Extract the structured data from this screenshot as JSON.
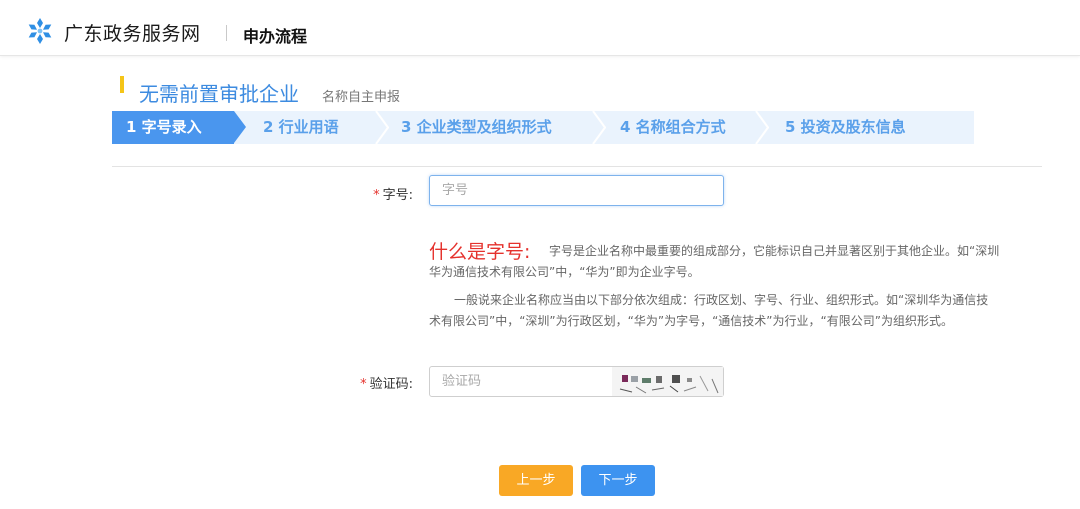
{
  "header": {
    "site_name": "广东政务服务网",
    "sub_title": "申办流程"
  },
  "title": {
    "main": "无需前置审批企业",
    "sub": "名称自主申报"
  },
  "steps": [
    {
      "label": "1 字号录入",
      "active": true
    },
    {
      "label": "2 行业用语",
      "active": false
    },
    {
      "label": "3 企业类型及组织形式",
      "active": false
    },
    {
      "label": "4 名称组合方式",
      "active": false
    },
    {
      "label": "5 投资及股东信息",
      "active": false
    }
  ],
  "form": {
    "name_label": "字号:",
    "name_placeholder": "字号",
    "captcha_label": "验证码:",
    "captcha_placeholder": "验证码"
  },
  "help": {
    "title": "什么是字号:",
    "para1_line1": "字号是企业名称中最重要的组成部分，它能标识自己并显著区别于其他企业。如“深圳",
    "para1_line2": "华为通信技术有限公司”中，“华为”即为企业字号。",
    "para2_line1": "一般说来企业名称应当由以下部分依次组成：行政区划、字号、行业、组织形式。如“深圳华为通信技",
    "para2_line2": "术有限公司”中，“深圳”为行政区划，“华为”为字号，“通信技术”为行业，“有限公司”为组织形式。"
  },
  "buttons": {
    "prev": "上一步",
    "next": "下一步"
  },
  "colors": {
    "accent_blue": "#4a96ee",
    "title_blue": "#3d8be0",
    "warning_red": "#e5322d",
    "prev_orange": "#f9a825",
    "title_marker_yellow": "#f5c518"
  },
  "icons": {
    "logo": "snowflake-logo-icon"
  }
}
